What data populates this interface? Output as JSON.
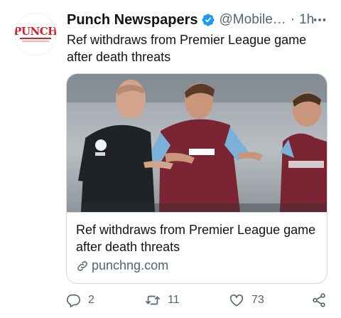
{
  "tweet": {
    "author": {
      "name": "Punch Newspapers",
      "handle": "@Mobile…",
      "avatar_logo": "PUNCH",
      "verified": true
    },
    "separator": "·",
    "time": "1h",
    "text": "Ref withdraws from Premier League game after death threats",
    "card": {
      "title": "Ref withdraws from Premier League game after death threats",
      "domain": "punchng.com",
      "image_alt": "Referee talking with football players"
    },
    "actions": {
      "reply_count": "2",
      "retweet_count": "11",
      "like_count": "73"
    }
  },
  "colors": {
    "text_primary": "#0f1419",
    "text_secondary": "#536471",
    "verified_blue": "#1d9bf0",
    "border": "#cfd9de",
    "logo_red": "#d2232a"
  },
  "icons": {
    "more": "more-horizontal-icon",
    "verified": "verified-badge-icon",
    "link": "link-icon",
    "reply": "reply-icon",
    "retweet": "retweet-icon",
    "like": "heart-icon",
    "share": "share-icon"
  }
}
